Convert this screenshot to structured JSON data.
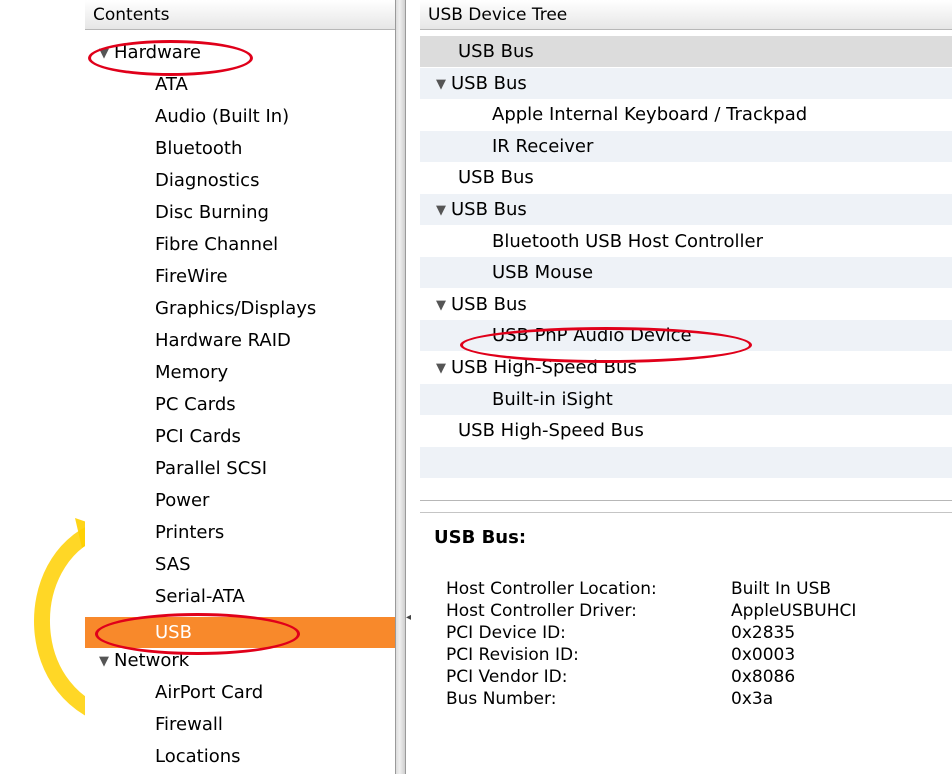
{
  "sidebar": {
    "header": "Contents",
    "items": [
      {
        "label": "Hardware",
        "level": 0,
        "expanded": true
      },
      {
        "label": "ATA",
        "level": 1
      },
      {
        "label": "Audio (Built In)",
        "level": 1
      },
      {
        "label": "Bluetooth",
        "level": 1
      },
      {
        "label": "Diagnostics",
        "level": 1
      },
      {
        "label": "Disc Burning",
        "level": 1
      },
      {
        "label": "Fibre Channel",
        "level": 1
      },
      {
        "label": "FireWire",
        "level": 1
      },
      {
        "label": "Graphics/Displays",
        "level": 1
      },
      {
        "label": "Hardware RAID",
        "level": 1
      },
      {
        "label": "Memory",
        "level": 1
      },
      {
        "label": "PC Cards",
        "level": 1
      },
      {
        "label": "PCI Cards",
        "level": 1
      },
      {
        "label": "Parallel SCSI",
        "level": 1
      },
      {
        "label": "Power",
        "level": 1
      },
      {
        "label": "Printers",
        "level": 1
      },
      {
        "label": "SAS",
        "level": 1
      },
      {
        "label": "Serial-ATA",
        "level": 1
      },
      {
        "label": "USB",
        "level": 1,
        "selected": true
      },
      {
        "label": "Network",
        "level": 0,
        "expanded": true
      },
      {
        "label": "AirPort Card",
        "level": 1
      },
      {
        "label": "Firewall",
        "level": 1
      },
      {
        "label": "Locations",
        "level": 1
      }
    ]
  },
  "device_tree": {
    "header": "USB Device Tree",
    "rows": [
      {
        "label": "USB Bus",
        "level": 0,
        "selected": true
      },
      {
        "label": "USB Bus",
        "level": 0,
        "expanded": true
      },
      {
        "label": "Apple Internal Keyboard / Trackpad",
        "level": 1
      },
      {
        "label": "IR Receiver",
        "level": 1
      },
      {
        "label": "USB Bus",
        "level": 0
      },
      {
        "label": "USB Bus",
        "level": 0,
        "expanded": true
      },
      {
        "label": "Bluetooth USB Host Controller",
        "level": 1
      },
      {
        "label": "USB Mouse",
        "level": 1
      },
      {
        "label": "USB Bus",
        "level": 0,
        "expanded": true
      },
      {
        "label": "USB PnP Audio Device",
        "level": 1
      },
      {
        "label": "USB High-Speed Bus",
        "level": 0,
        "expanded": true
      },
      {
        "label": "Built-in iSight",
        "level": 1
      },
      {
        "label": "USB High-Speed Bus",
        "level": 0
      }
    ]
  },
  "detail": {
    "title": "USB Bus:",
    "fields": [
      {
        "key": "Host Controller Location:",
        "value": "Built In USB"
      },
      {
        "key": "Host Controller Driver:",
        "value": "AppleUSBUHCI"
      },
      {
        "key": "PCI Device ID:",
        "value": "0x2835"
      },
      {
        "key": "PCI Revision ID:",
        "value": "0x0003"
      },
      {
        "key": "PCI Vendor ID:",
        "value": "0x8086"
      },
      {
        "key": "Bus Number:",
        "value": "0x3a"
      }
    ]
  },
  "icons": {
    "disclosure_expanded": "disclosure-triangle-down-icon",
    "divider_handle": "split-caret-icon"
  },
  "colors": {
    "selection": "#f8892b",
    "annotation": "#e0001a",
    "stripe": "#eef2f7",
    "deco_arc": "#ffd400"
  }
}
